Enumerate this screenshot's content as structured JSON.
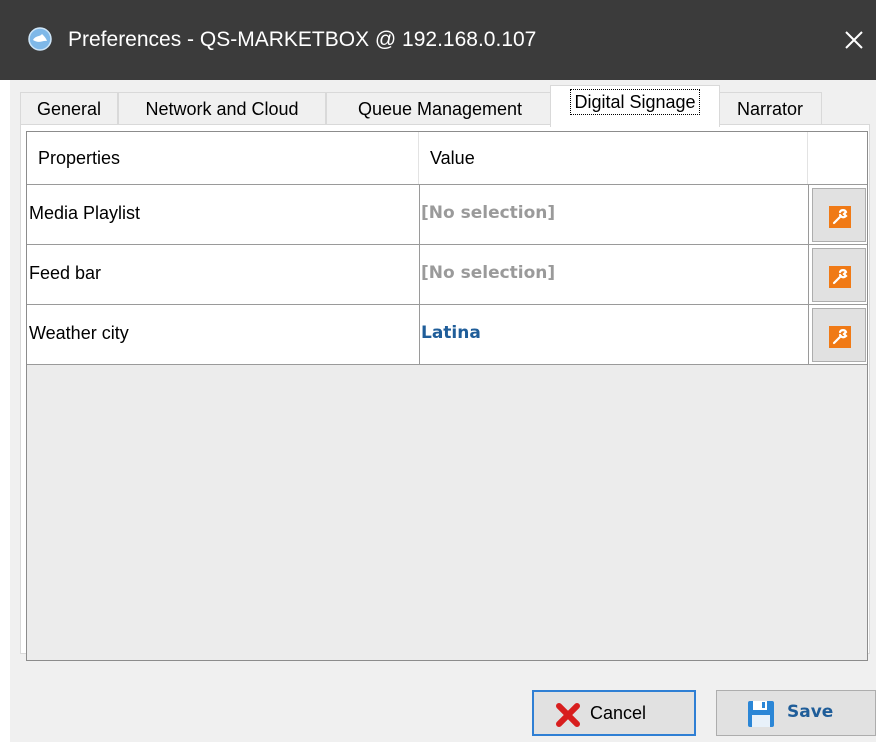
{
  "window": {
    "title": "Preferences - QS-MARKETBOX @ 192.168.0.107",
    "icon": "globe-icon",
    "close_icon": "close-icon"
  },
  "tabs": [
    {
      "label": "General",
      "active": false
    },
    {
      "label": "Network and Cloud",
      "active": false
    },
    {
      "label": "Queue Management",
      "active": false
    },
    {
      "label": "Digital Signage",
      "active": true
    },
    {
      "label": "Narrator",
      "active": false
    }
  ],
  "grid": {
    "columns": [
      "Properties",
      "Value"
    ],
    "rows": [
      {
        "property": "Media Playlist",
        "value": "[No selection]",
        "edit_icon": "wrench-icon"
      },
      {
        "property": "Feed bar",
        "value": "[No selection]",
        "edit_icon": "wrench-icon"
      },
      {
        "property": "Weather city",
        "value": "Latina",
        "edit_icon": "wrench-icon"
      }
    ]
  },
  "buttons": {
    "cancel": {
      "label": "Cancel",
      "icon": "red-x-icon"
    },
    "save": {
      "label": "Save",
      "icon": "floppy-disk-icon"
    }
  },
  "colors": {
    "titlebar": "#3b3b3b",
    "accent_orange": "#f07a16",
    "value_blue": "#1f5d99",
    "placeholder_gray": "#9a9a9a",
    "focus_blue": "#2f7fd4"
  }
}
